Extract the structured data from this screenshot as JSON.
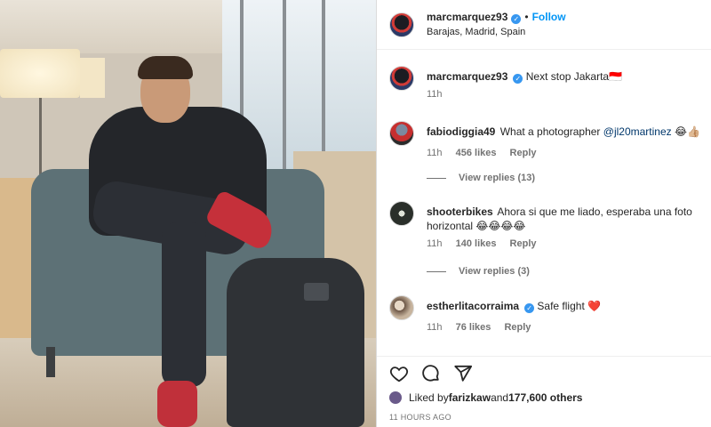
{
  "post": {
    "username": "marcmarquez93",
    "follow_label": "Follow",
    "location": "Barajas, Madrid, Spain",
    "separator": "•"
  },
  "caption": {
    "username": "marcmarquez93",
    "text": "Next stop Jakarta🇮🇩",
    "time": "11h"
  },
  "comments": [
    {
      "username": "fabiodiggia49",
      "text_before": "What a photographer ",
      "mention": "@jl20martinez",
      "text_after": " 😂👍🏼",
      "time": "11h",
      "likes": "456 likes",
      "reply": "Reply",
      "view_replies": "View replies (13)"
    },
    {
      "username": "shooterbikes",
      "text": "Ahora si que me liado, esperaba una foto horizontal 😂😂😂😂",
      "time": "11h",
      "likes": "140 likes",
      "reply": "Reply",
      "view_replies": "View replies (3)"
    },
    {
      "username": "estherlitacorraima",
      "text": "Safe flight ❤️",
      "time": "11h",
      "likes": "76 likes",
      "reply": "Reply"
    }
  ],
  "likes": {
    "prefix": "Liked by ",
    "user": "farizkaw",
    "middle": " and ",
    "others": "177,600 others"
  },
  "timestamp": "11 HOURS AGO",
  "colors": {
    "accent": "#0095f6",
    "verified": "#3797f0",
    "muted": "#737373"
  }
}
